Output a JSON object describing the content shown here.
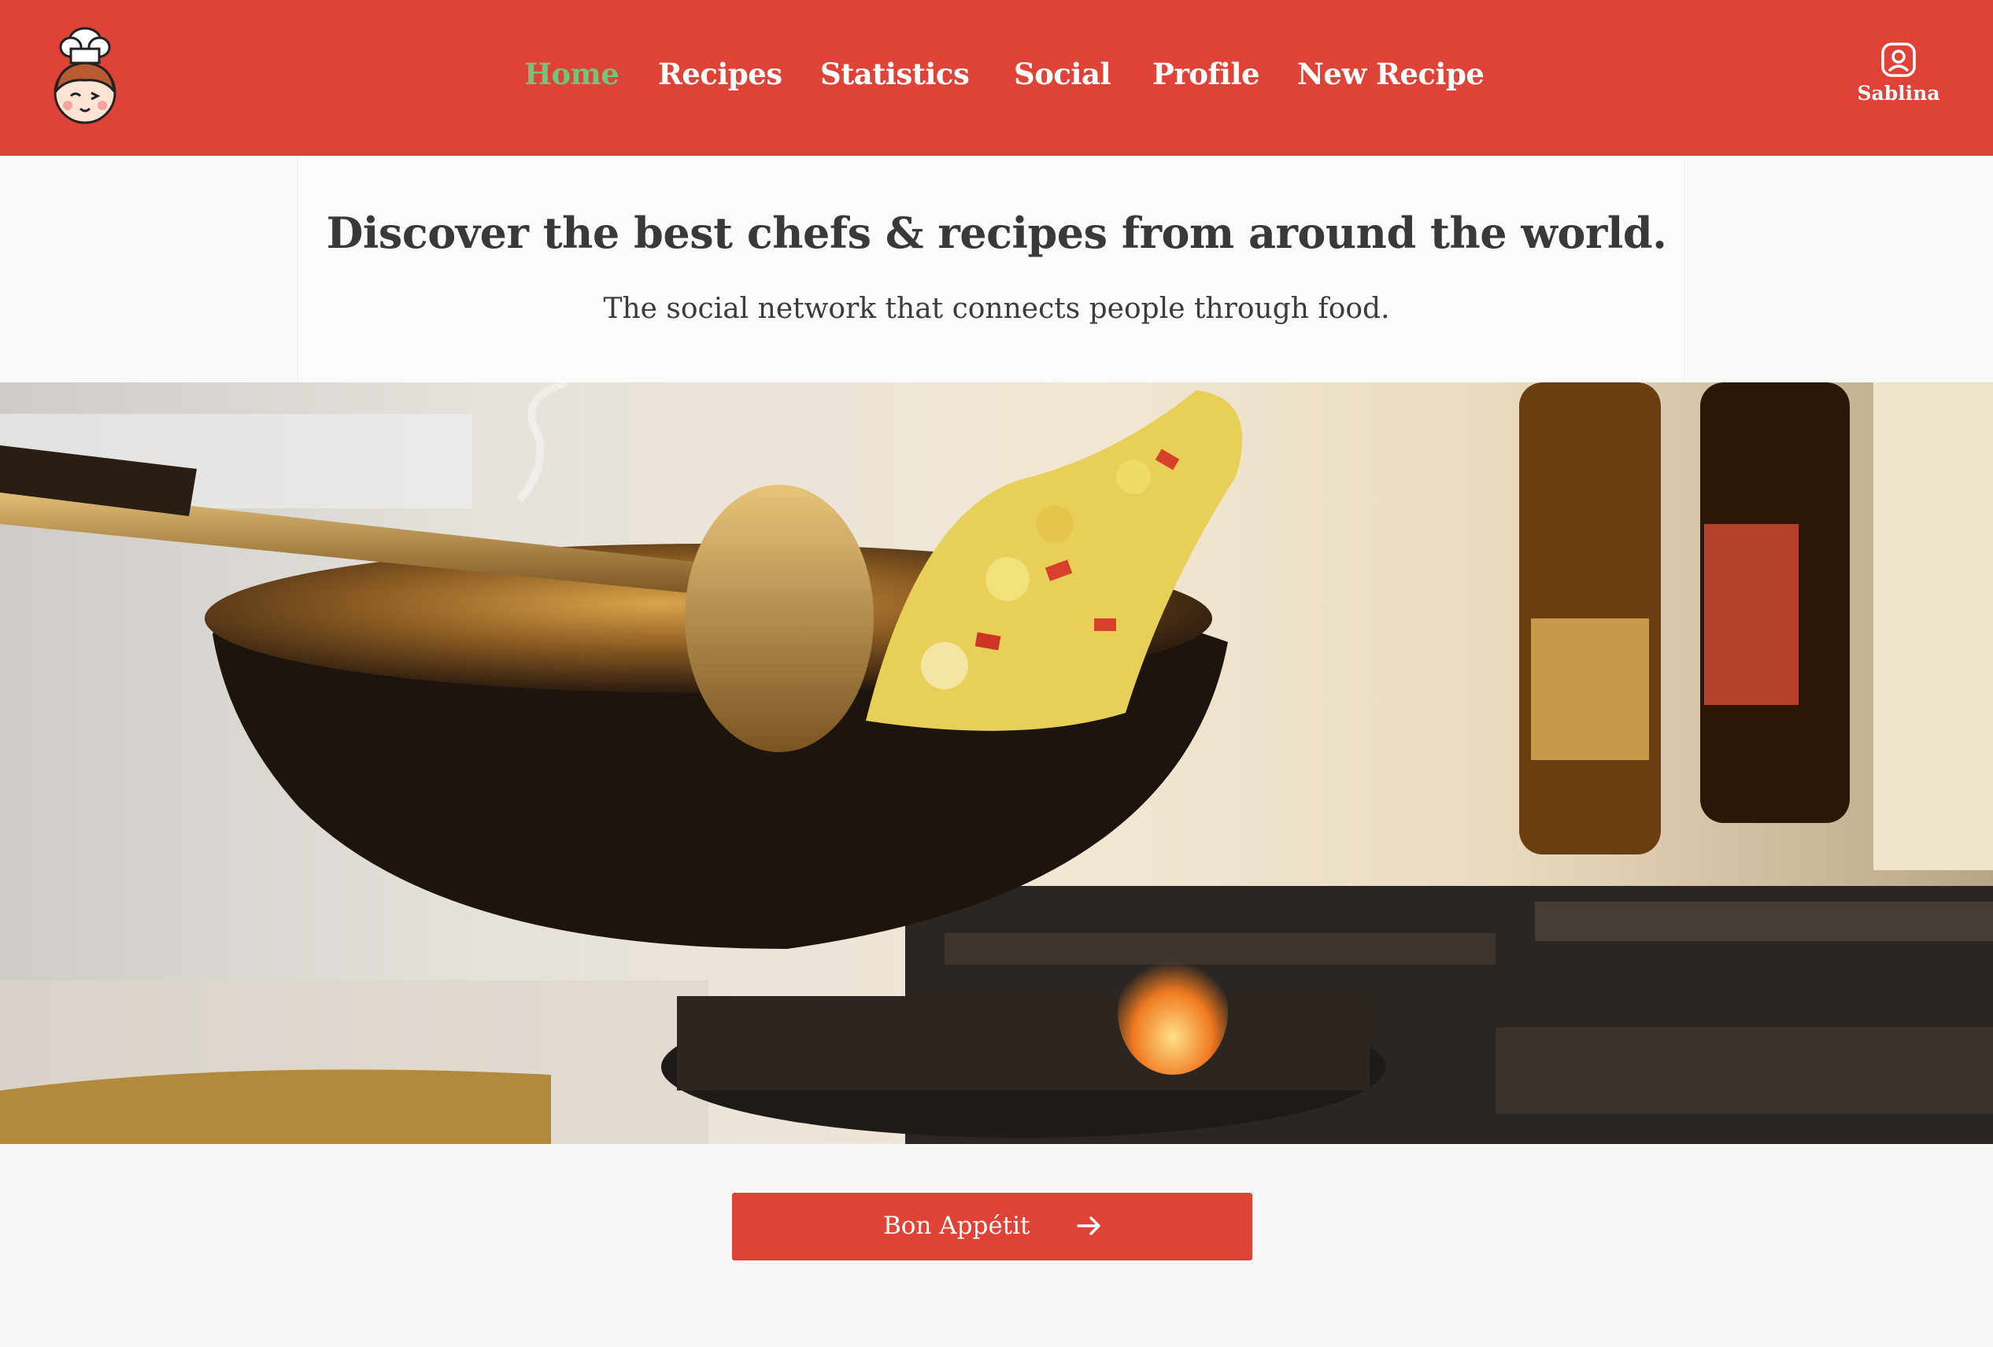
{
  "header": {
    "logo_icon": "chef-girl-logo-icon",
    "nav": [
      {
        "label": "Home",
        "active": true
      },
      {
        "label": "Recipes",
        "active": false
      },
      {
        "label": "Statistics",
        "active": false
      },
      {
        "label": "Social",
        "active": false
      },
      {
        "label": "Profile",
        "active": false
      },
      {
        "label": "New Recipe",
        "active": false
      }
    ],
    "user": {
      "icon": "user-icon",
      "name": "Sablina"
    }
  },
  "hero": {
    "headline": "Discover the best chefs & recipes from around the world.",
    "subline": "The social network that connects people through food.",
    "image": "wok-stir-fry-photo"
  },
  "cta": {
    "label": "Bon Appétit",
    "icon": "arrow-right-icon"
  },
  "colors": {
    "brand": "#df4236",
    "nav_active": "#74c37c",
    "nav_text": "#ffffff",
    "heading": "#393939"
  }
}
